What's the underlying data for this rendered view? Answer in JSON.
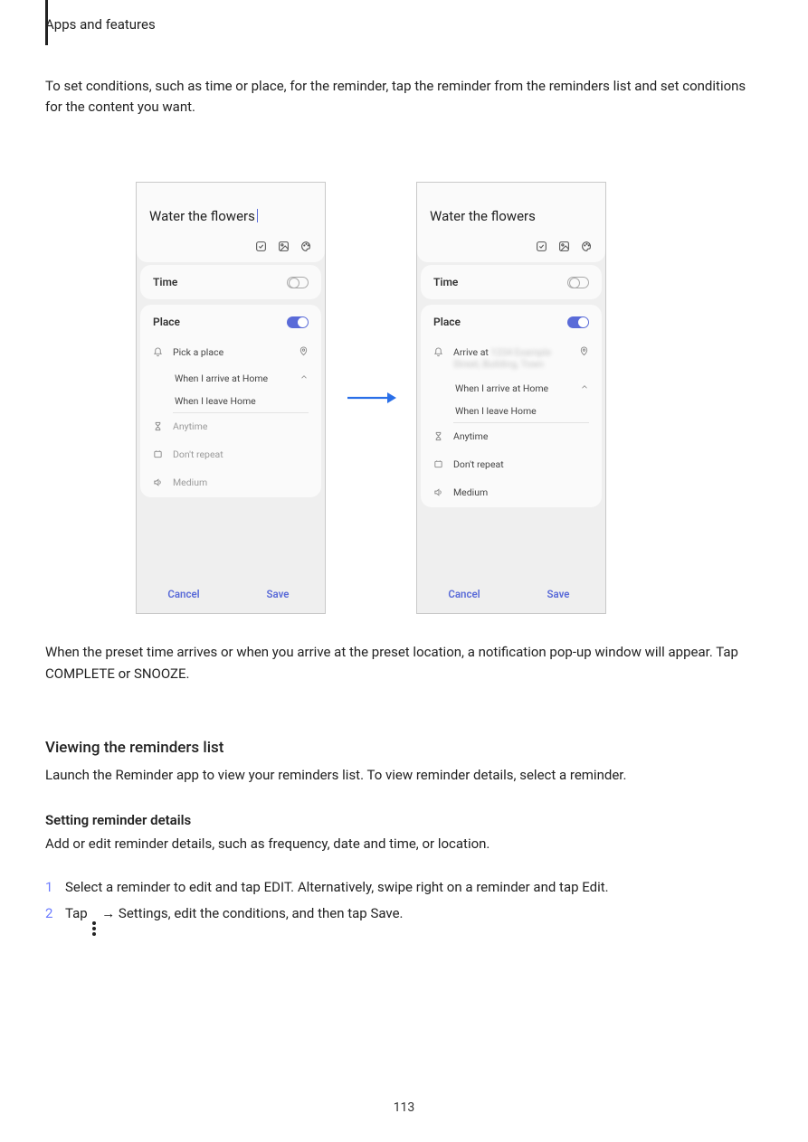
{
  "doc": {
    "section": "Apps and features",
    "intro": "To set conditions, such as time or place, for the reminder, tap the reminder from the reminders list and set conditions for the content you want.",
    "below": "When the preset time arrives or when you arrive at the preset location, a notification pop-up window will appear. Tap COMPLETE or SNOOZE.",
    "subhead": "Viewing the reminders list",
    "subpara": "Launch the Reminder app to view your reminders list. To view reminder details, select a reminder.",
    "steps_head": "Setting reminder details",
    "steps_intro": "Add or edit reminder details, such as frequency, date and time, or location.",
    "step1": "Select a reminder to edit and tap EDIT. Alternatively, swipe right on a reminder and tap Edit.",
    "step2_a": "Tap",
    "step2_b": " → Settings, edit the conditions, and then tap Save.",
    "pagenum": "113"
  },
  "screens": {
    "left": {
      "title": "Water the flowers",
      "time_label": "Time",
      "place_label": "Place",
      "pick_place": "Pick a place",
      "opt_arrive": "When I arrive at Home",
      "opt_leave": "When I leave Home",
      "anytime": "Anytime",
      "repeat": "Don't repeat",
      "volume": "Medium",
      "cancel": "Cancel",
      "save": "Save"
    },
    "right": {
      "title": "Water the flowers",
      "time_label": "Time",
      "place_label": "Place",
      "arrive_prefix": "Arrive at ",
      "arrive_blur": "1234 Example Street, Building, Town",
      "opt_arrive": "When I arrive at Home",
      "opt_leave": "When I leave Home",
      "anytime": "Anytime",
      "repeat": "Don't repeat",
      "volume": "Medium",
      "cancel": "Cancel",
      "save": "Save"
    }
  }
}
